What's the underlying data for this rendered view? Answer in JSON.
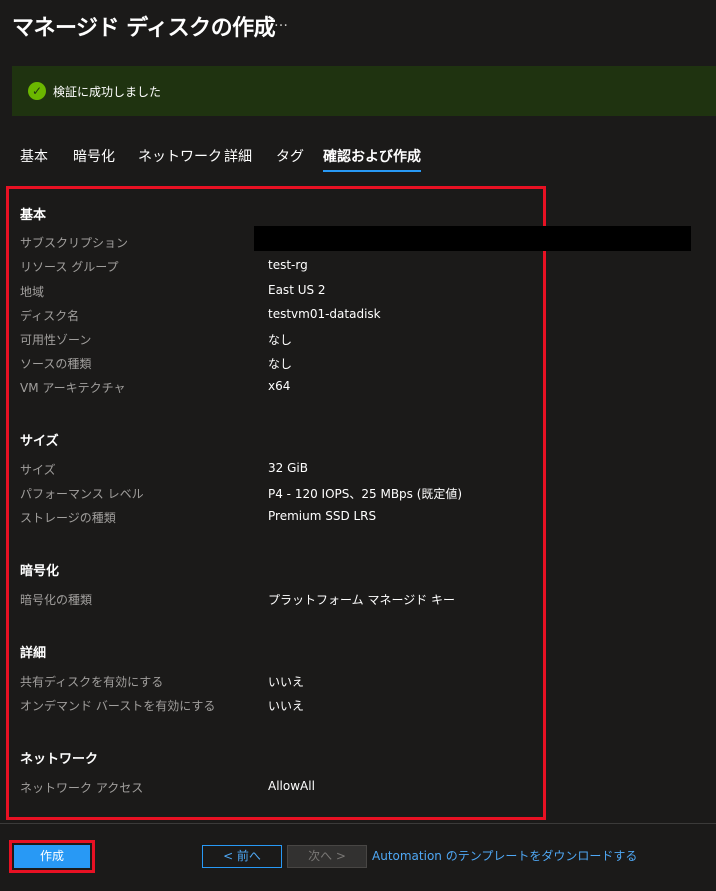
{
  "header": {
    "title": "マネージド ディスクの作成",
    "more_label": "…"
  },
  "banner": {
    "icon": "checkmark-circle-icon",
    "message": "検証に成功しました",
    "color": "#1f3310",
    "icon_color": "#6bb700"
  },
  "tabs": [
    {
      "label": "基本"
    },
    {
      "label": "暗号化"
    },
    {
      "label": "ネットワーク"
    },
    {
      "label": "詳細"
    },
    {
      "label": "タグ"
    },
    {
      "label": "確認および作成",
      "active": true
    }
  ],
  "sections": {
    "basic": {
      "title": "基本",
      "rows": [
        {
          "label": "サブスクリプション",
          "value": ""
        },
        {
          "label": "リソース グループ",
          "value": "test-rg"
        },
        {
          "label": "地域",
          "value": "East US 2"
        },
        {
          "label": "ディスク名",
          "value": "testvm01-datadisk"
        },
        {
          "label": "可用性ゾーン",
          "value": "なし"
        },
        {
          "label": "ソースの種類",
          "value": "なし"
        },
        {
          "label": "VM アーキテクチャ",
          "value": "x64"
        }
      ]
    },
    "size": {
      "title": "サイズ",
      "rows": [
        {
          "label": "サイズ",
          "value": "32 GiB"
        },
        {
          "label": "パフォーマンス レベル",
          "value": "P4 - 120 IOPS、25 MBps (既定値)"
        },
        {
          "label": "ストレージの種類",
          "value": "Premium SSD LRS"
        }
      ]
    },
    "encryption": {
      "title": "暗号化",
      "rows": [
        {
          "label": "暗号化の種類",
          "value": "プラットフォーム マネージド キー"
        }
      ]
    },
    "advanced": {
      "title": "詳細",
      "rows": [
        {
          "label": "共有ディスクを有効にする",
          "value": "いいえ"
        },
        {
          "label": "オンデマンド バーストを有効にする",
          "value": "いいえ"
        }
      ]
    },
    "network": {
      "title": "ネットワーク",
      "rows": [
        {
          "label": "ネットワーク アクセス",
          "value": "AllowAll"
        }
      ]
    }
  },
  "footer": {
    "create_label": "作成",
    "prev_label": "< 前へ",
    "next_label": "次へ >",
    "automation_link": "Automation のテンプレートをダウンロードする"
  },
  "colors": {
    "accent": "#2899f5",
    "highlight": "#e81123",
    "background": "#1b1a19"
  }
}
